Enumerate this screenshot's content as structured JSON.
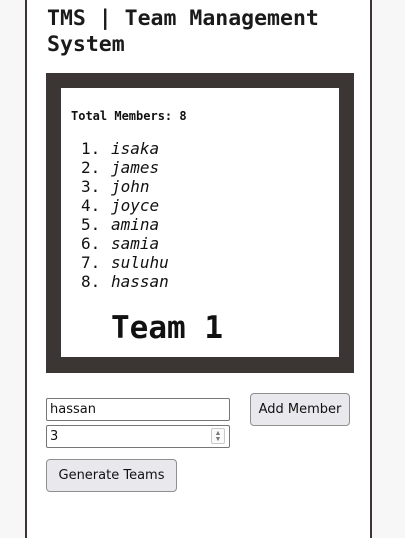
{
  "header": {
    "title": "TMS | Team Management System"
  },
  "team": {
    "total_label": "Total Members: 8",
    "members": [
      {
        "num": "1.",
        "name": "isaka"
      },
      {
        "num": "2.",
        "name": "james"
      },
      {
        "num": "3.",
        "name": "john"
      },
      {
        "num": "4.",
        "name": "joyce"
      },
      {
        "num": "5.",
        "name": "amina"
      },
      {
        "num": "6.",
        "name": "samia"
      },
      {
        "num": "7.",
        "name": "suluhu"
      },
      {
        "num": "8.",
        "name": "hassan"
      }
    ],
    "name": "Team 1"
  },
  "form": {
    "member_name_value": "hassan",
    "team_count_value": "3",
    "add_member_label": "Add Member",
    "generate_teams_label": "Generate Teams"
  },
  "icons": {
    "spinner_up": "chevron-up-icon",
    "spinner_down": "chevron-down-icon"
  },
  "colors": {
    "frame": "#3b3534",
    "button_bg": "#e9e9ed"
  }
}
